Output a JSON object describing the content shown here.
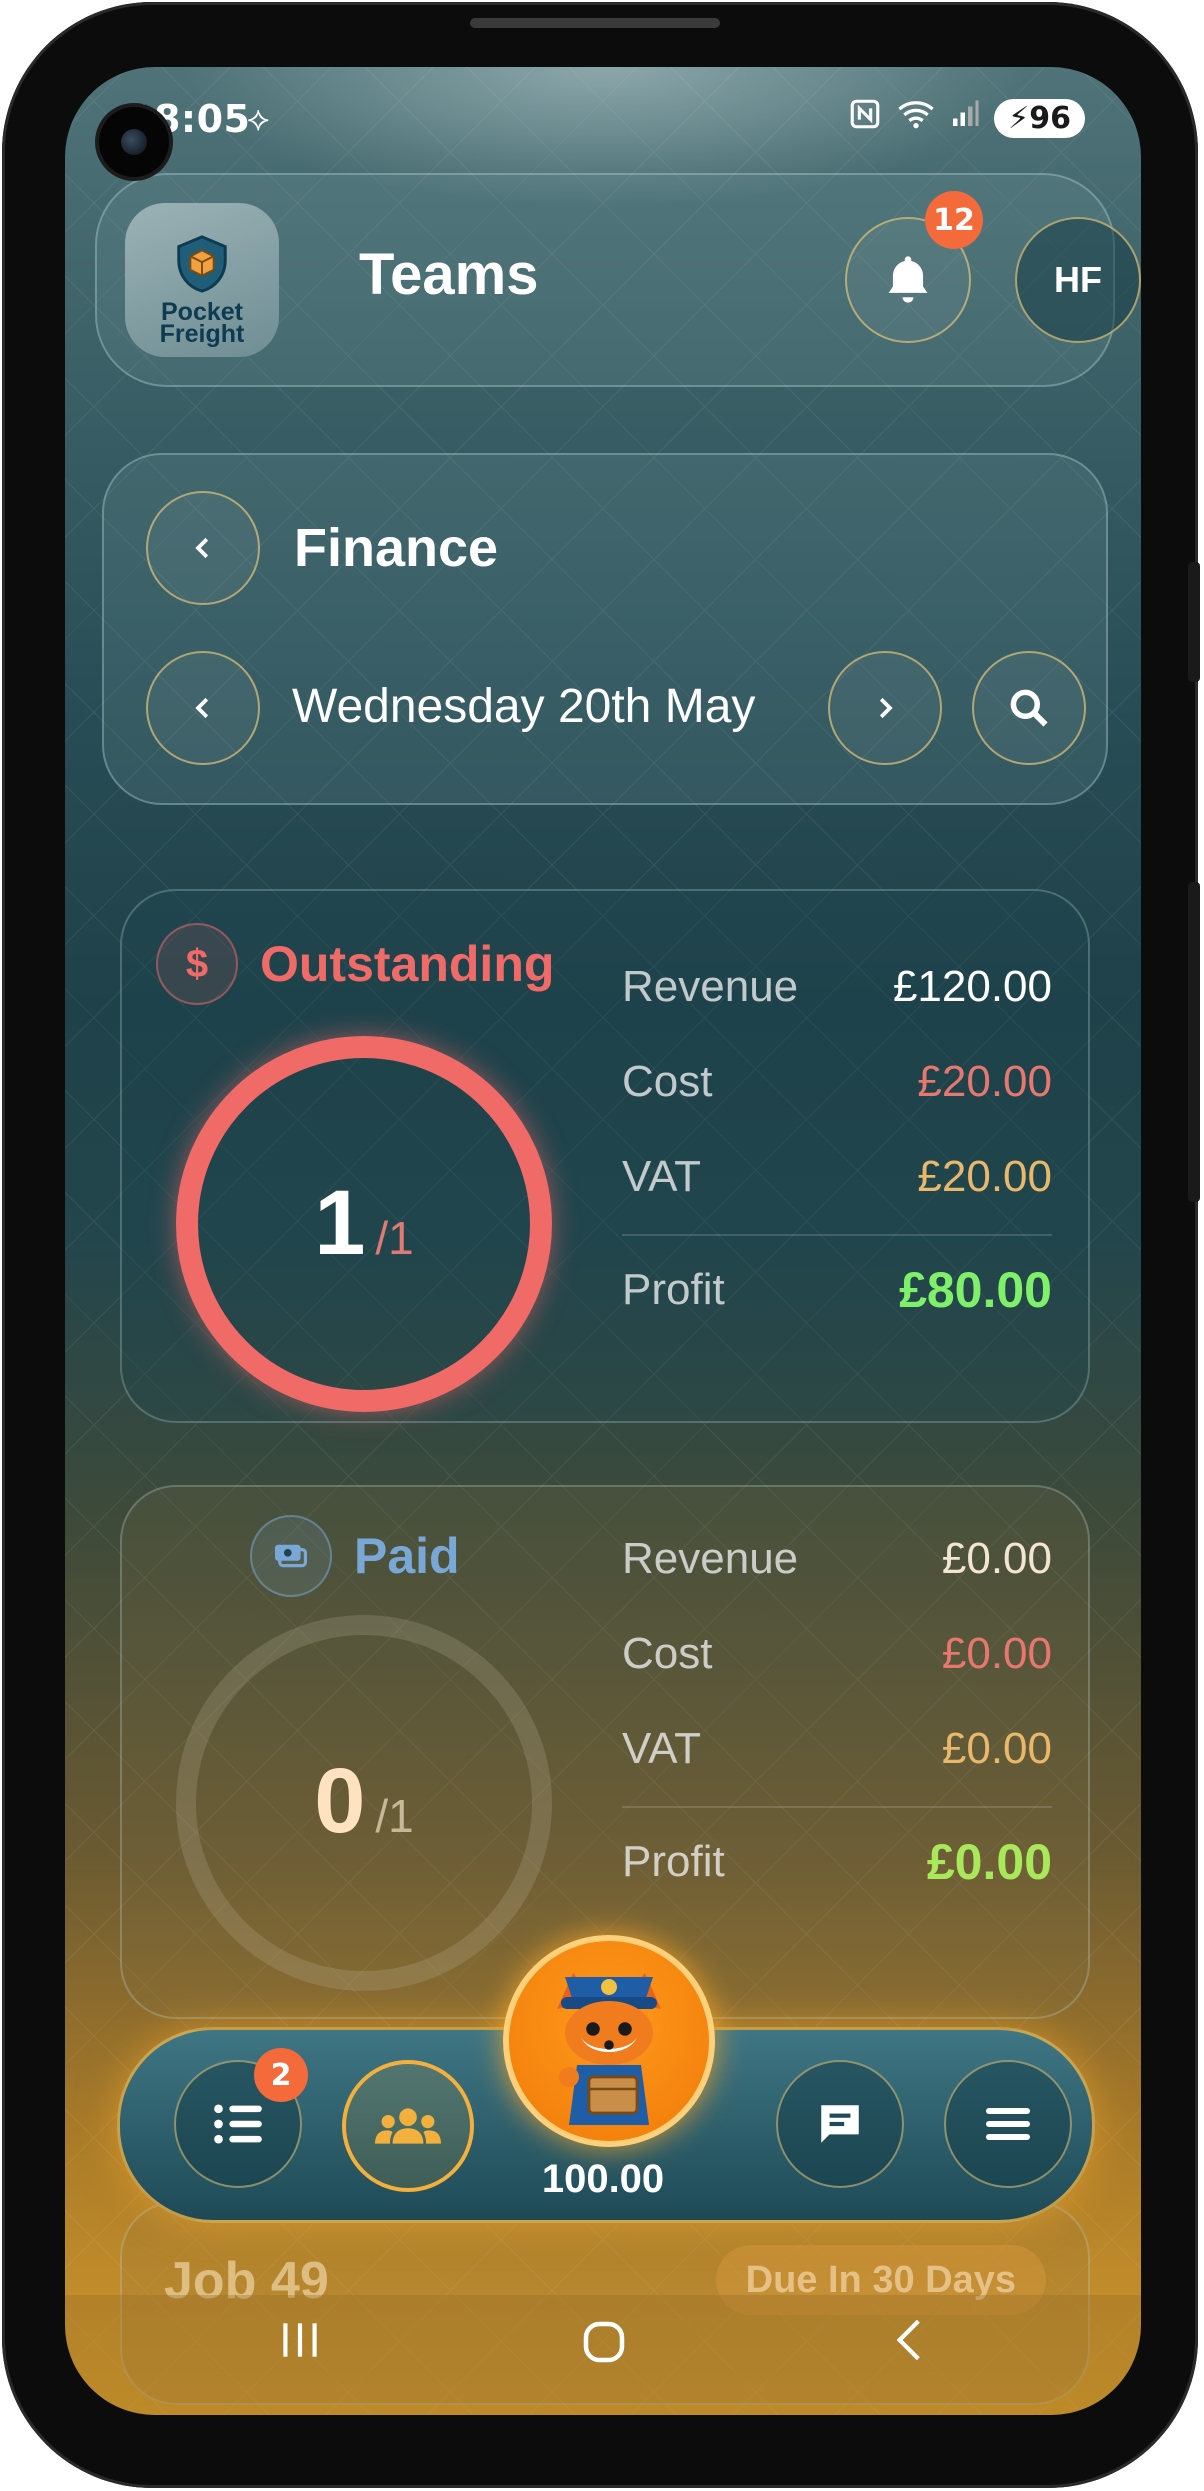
{
  "status": {
    "time": "18:05",
    "battery": "96"
  },
  "header": {
    "logo_line1": "Pocket",
    "logo_line2": "Freight",
    "title": "Teams",
    "notifications": "12",
    "avatar": "HF"
  },
  "filter": {
    "section": "Finance",
    "date": "Wednesday 20th May"
  },
  "outstanding": {
    "label": "Outstanding",
    "icon_glyph": "$",
    "count": "1",
    "total": "/1",
    "progress": 1.0,
    "accent": "#f06a68",
    "revenue_label": "Revenue",
    "revenue": "£120.00",
    "cost_label": "Cost",
    "cost": "£20.00",
    "vat_label": "VAT",
    "vat": "£20.00",
    "profit_label": "Profit",
    "profit": "£80.00"
  },
  "paid": {
    "label": "Paid",
    "count": "0",
    "total": "/1",
    "progress": 0.0,
    "accent": "#7aa8d6",
    "revenue_label": "Revenue",
    "revenue": "£0.00",
    "cost_label": "Cost",
    "cost": "£0.00",
    "vat_label": "VAT",
    "vat": "£0.00",
    "profit_label": "Profit",
    "profit": "£0.00"
  },
  "job": {
    "title": "Job 49",
    "due": "Due In 30 Days"
  },
  "bottom_nav": {
    "list_badge": "2",
    "credits": "100.00"
  },
  "colors": {
    "positive": "#7ef06a",
    "cost": "#e7776f",
    "vat": "#e9b86a"
  }
}
